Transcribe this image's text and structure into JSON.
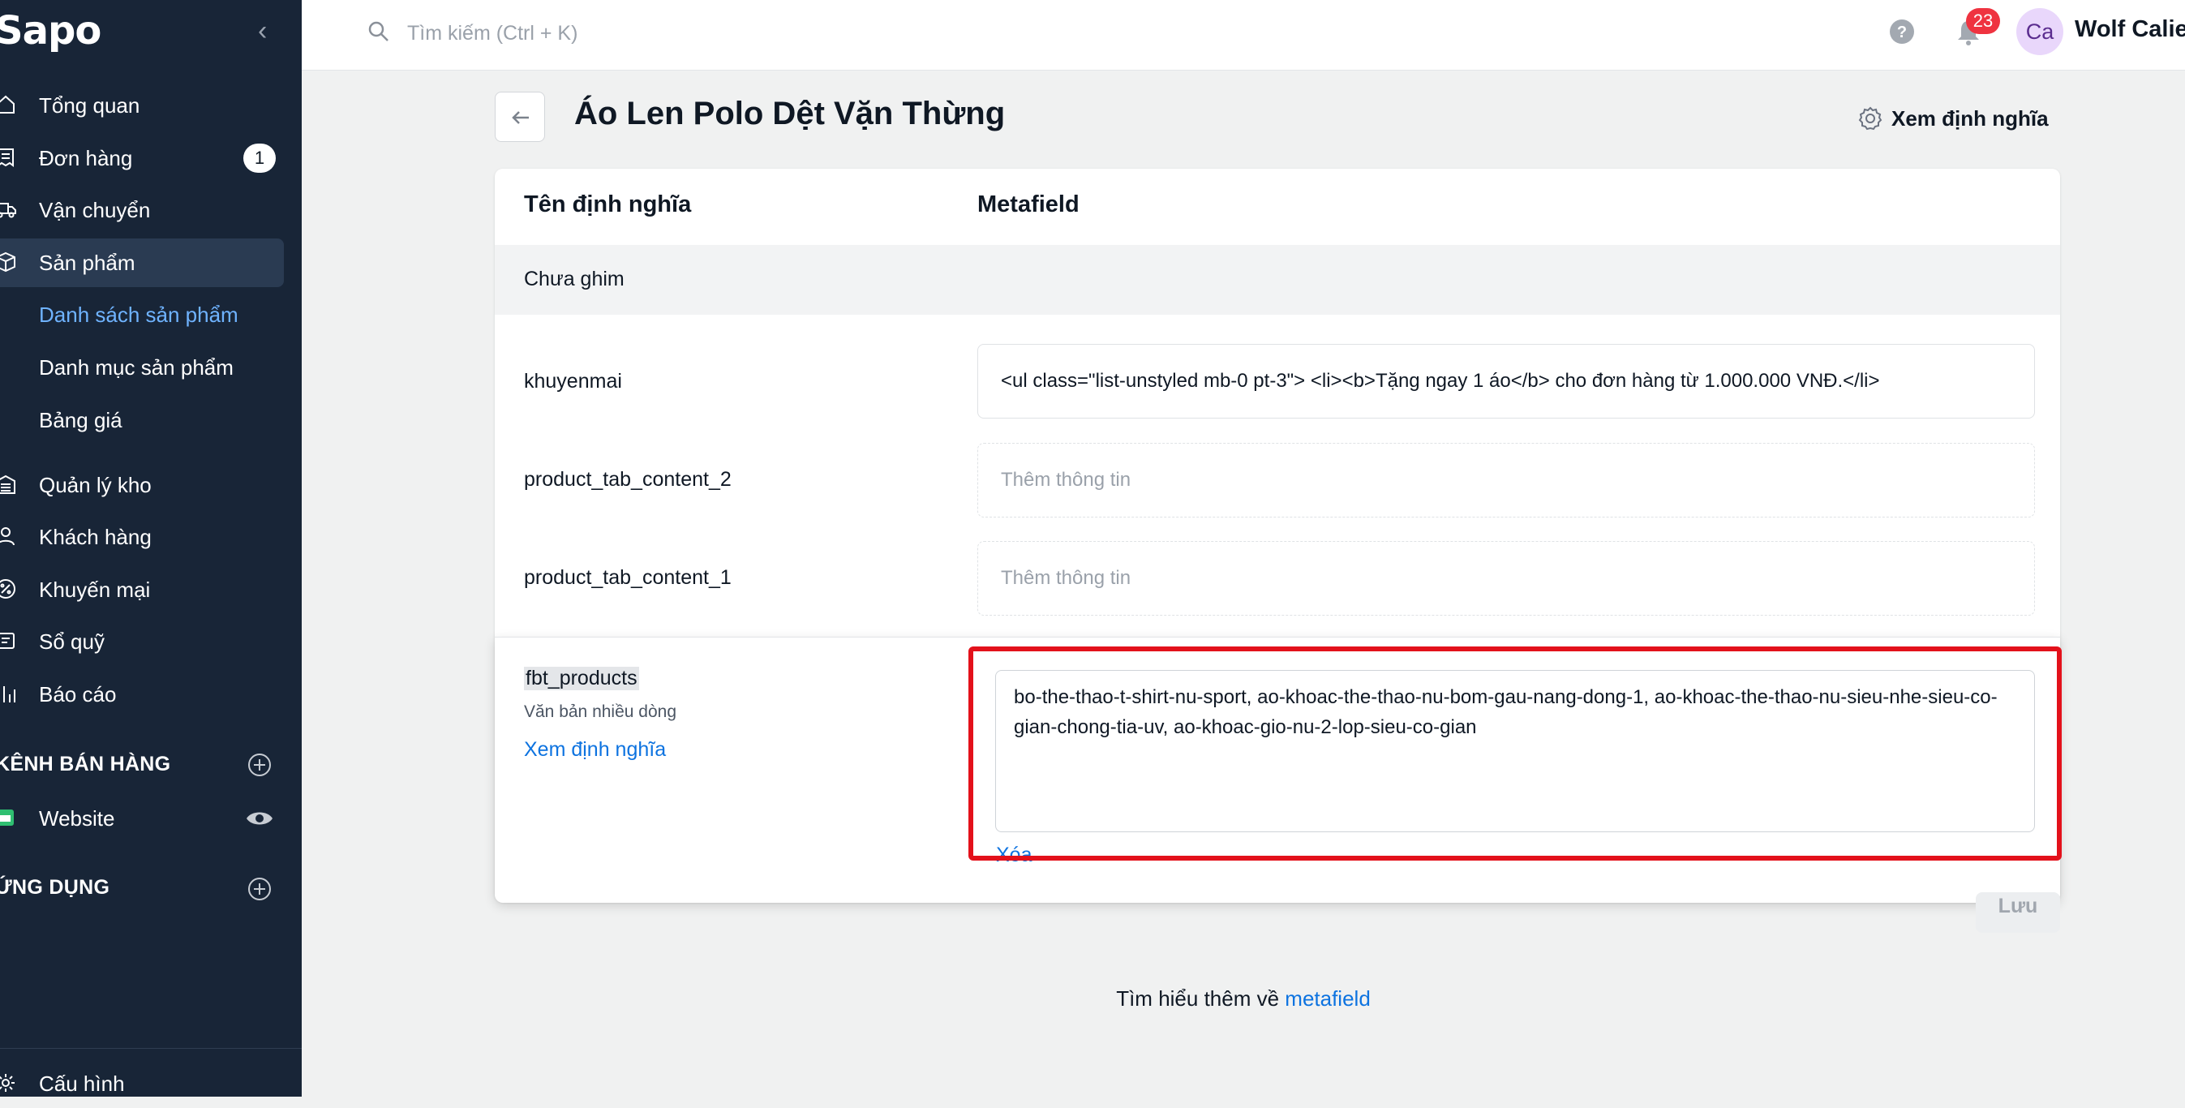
{
  "sidebar": {
    "logo": "Sapo",
    "items": [
      {
        "label": "Tổng quan",
        "icon": "home-icon"
      },
      {
        "label": "Đơn hàng",
        "icon": "receipt-icon",
        "badge": "1"
      },
      {
        "label": "Vận chuyển",
        "icon": "truck-icon"
      },
      {
        "label": "Sản phẩm",
        "icon": "box-icon",
        "active": true
      },
      {
        "label": "Quản lý kho",
        "icon": "warehouse-icon"
      },
      {
        "label": "Khách hàng",
        "icon": "user-icon"
      },
      {
        "label": "Khuyến mại",
        "icon": "discount-icon"
      },
      {
        "label": "Sổ quỹ",
        "icon": "cashbook-icon"
      },
      {
        "label": "Báo cáo",
        "icon": "chart-icon"
      }
    ],
    "product_sub": [
      "Danh sách sản phẩm",
      "Danh mục sản phẩm",
      "Bảng giá"
    ],
    "channels_heading": "KÊNH BÁN HÀNG",
    "website_label": "Website",
    "apps_heading": "ỨNG DỤNG",
    "settings_label": "Cấu hình"
  },
  "topbar": {
    "search_placeholder": "Tìm kiếm (Ctrl + K)",
    "notification_count": "23",
    "avatar_initials": "Ca",
    "user_name": "Wolf Calie"
  },
  "page": {
    "title": "Áo Len Polo Dệt Vặn Thừng",
    "view_definition": "Xem định nghĩa"
  },
  "table": {
    "col_name": "Tên định nghĩa",
    "col_metafield": "Metafield",
    "unpinned_label": "Chưa ghim",
    "rows": [
      {
        "name": "khuyenmai",
        "value": "<ul class=\"list-unstyled mb-0 pt-3\"> <li><b>Tặng ngay 1 áo</b> cho đơn hàng từ 1.000.000 VNĐ.</li>"
      },
      {
        "name": "product_tab_content_2",
        "placeholder": "Thêm thông tin"
      },
      {
        "name": "product_tab_content_1",
        "placeholder": "Thêm thông tin"
      }
    ],
    "active_row": {
      "name": "fbt_products",
      "type": "Văn bản nhiều dòng",
      "view_definition": "Xem định nghĩa",
      "value": "bo-the-thao-t-shirt-nu-sport, ao-khoac-the-thao-nu-bom-gau-nang-dong-1, ao-khoac-the-thao-nu-sieu-nhe-sieu-co-gian-chong-tia-uv, ao-khoac-gio-nu-2-lop-sieu-co-gian",
      "delete_label": "Xóa"
    }
  },
  "save_label": "Lưu",
  "footer": {
    "text": "Tìm hiểu thêm về ",
    "link": "metafield"
  },
  "colors": {
    "sidebar_bg": "#182537",
    "accent": "#0d73e0",
    "highlight": "#e3111b",
    "badge": "#ef3340"
  }
}
